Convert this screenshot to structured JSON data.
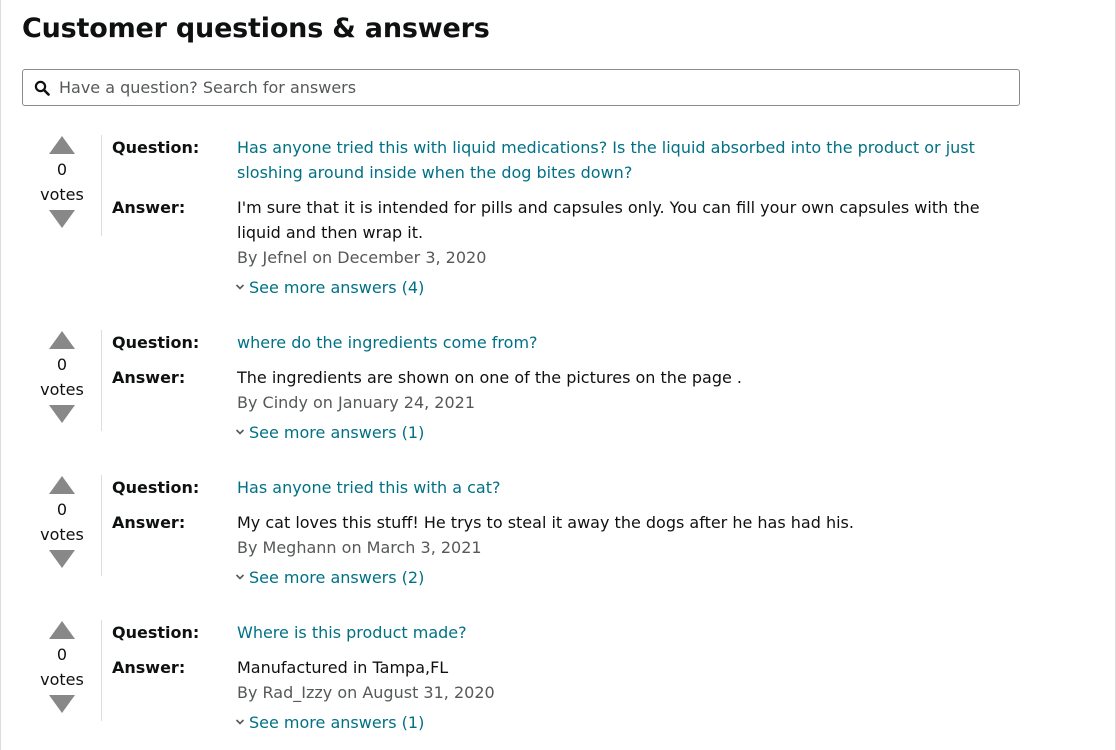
{
  "page": {
    "title": "Customer questions & answers"
  },
  "search": {
    "placeholder": "Have a question? Search for answers",
    "icon": "search-icon"
  },
  "labels": {
    "question": "Question:",
    "answer": "Answer:",
    "votes": "votes"
  },
  "colors": {
    "link": "#007185",
    "text": "#0f1111",
    "secondary_text": "#565959",
    "vote_arrow": "#888888",
    "divider": "#dddddd"
  },
  "qa_items": [
    {
      "votes": "0",
      "question": "Has anyone tried this with liquid medications? Is the liquid absorbed into the product or just sloshing around inside when the dog bites down?",
      "answer": "I'm sure that it is intended for pills and capsules only. You can fill your own capsules with the liquid and then wrap it.",
      "byline": "By Jefnel on December 3, 2020",
      "see_more": "See more answers (4)"
    },
    {
      "votes": "0",
      "question": "where do the ingredients come from?",
      "answer": "The ingredients are shown on one of the pictures on the page .",
      "byline": "By Cindy on January 24, 2021",
      "see_more": "See more answers (1)"
    },
    {
      "votes": "0",
      "question": "Has anyone tried this with a cat?",
      "answer": "My cat loves this stuff! He trys to steal it away the dogs after he has had his.",
      "byline": "By Meghann on March 3, 2021",
      "see_more": "See more answers (2)"
    },
    {
      "votes": "0",
      "question": "Where is this product made?",
      "answer": "Manufactured in Tampa,FL",
      "byline": "By Rad_Izzy on August 31, 2020",
      "see_more": "See more answers (1)"
    }
  ]
}
